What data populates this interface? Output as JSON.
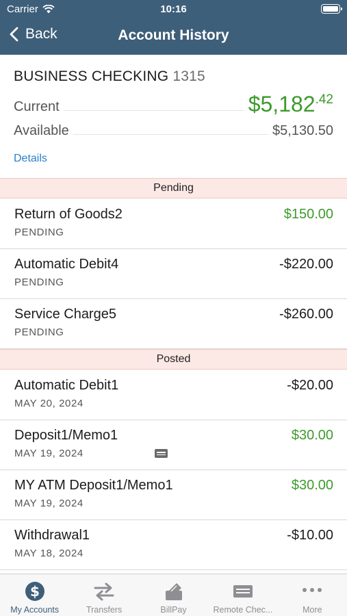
{
  "status_bar": {
    "carrier": "Carrier",
    "time": "10:16"
  },
  "nav": {
    "back_label": "Back",
    "title": "Account History"
  },
  "account": {
    "name": "BUSINESS CHECKING",
    "number": "1315",
    "current_label": "Current",
    "current_dollars": "$5,182",
    "current_cents": ".42",
    "available_label": "Available",
    "available_amount": "$5,130.50",
    "details_label": "Details"
  },
  "sections": {
    "pending": "Pending",
    "posted": "Posted"
  },
  "pending": [
    {
      "desc": "Return of Goods2",
      "status": "PENDING",
      "amount": "$150.00",
      "positive": true
    },
    {
      "desc": "Automatic Debit4",
      "status": "PENDING",
      "amount": "-$220.00",
      "positive": false
    },
    {
      "desc": "Service Charge5",
      "status": "PENDING",
      "amount": "-$260.00",
      "positive": false
    }
  ],
  "posted": [
    {
      "desc": "Automatic Debit1",
      "date": "MAY 20, 2024",
      "amount": "-$20.00",
      "positive": false
    },
    {
      "desc": "Deposit1/Memo1",
      "date": "MAY 19, 2024",
      "amount": "$30.00",
      "positive": true,
      "icon": "memo-icon"
    },
    {
      "desc": "MY ATM Deposit1/Memo1",
      "date": "MAY 19, 2024",
      "amount": "$30.00",
      "positive": true
    },
    {
      "desc": "Withdrawal1",
      "date": "MAY 18, 2024",
      "amount": "-$10.00",
      "positive": false
    }
  ],
  "tabs": [
    {
      "label": "My Accounts",
      "icon": "dollar-circle-icon",
      "active": true
    },
    {
      "label": "Transfers",
      "icon": "transfer-arrows-icon",
      "active": false
    },
    {
      "label": "BillPay",
      "icon": "billpay-icon",
      "active": false
    },
    {
      "label": "Remote Chec...",
      "icon": "check-deposit-icon",
      "active": false
    },
    {
      "label": "More",
      "icon": "more-dots-icon",
      "active": false
    }
  ],
  "colors": {
    "nav_bg": "#3e5f7a",
    "positive": "#3d9a2c",
    "section_bg": "#fce8e4",
    "link": "#2a7fc9",
    "tab_active": "#3e5f7a",
    "tab_inactive": "#8e8e93"
  }
}
